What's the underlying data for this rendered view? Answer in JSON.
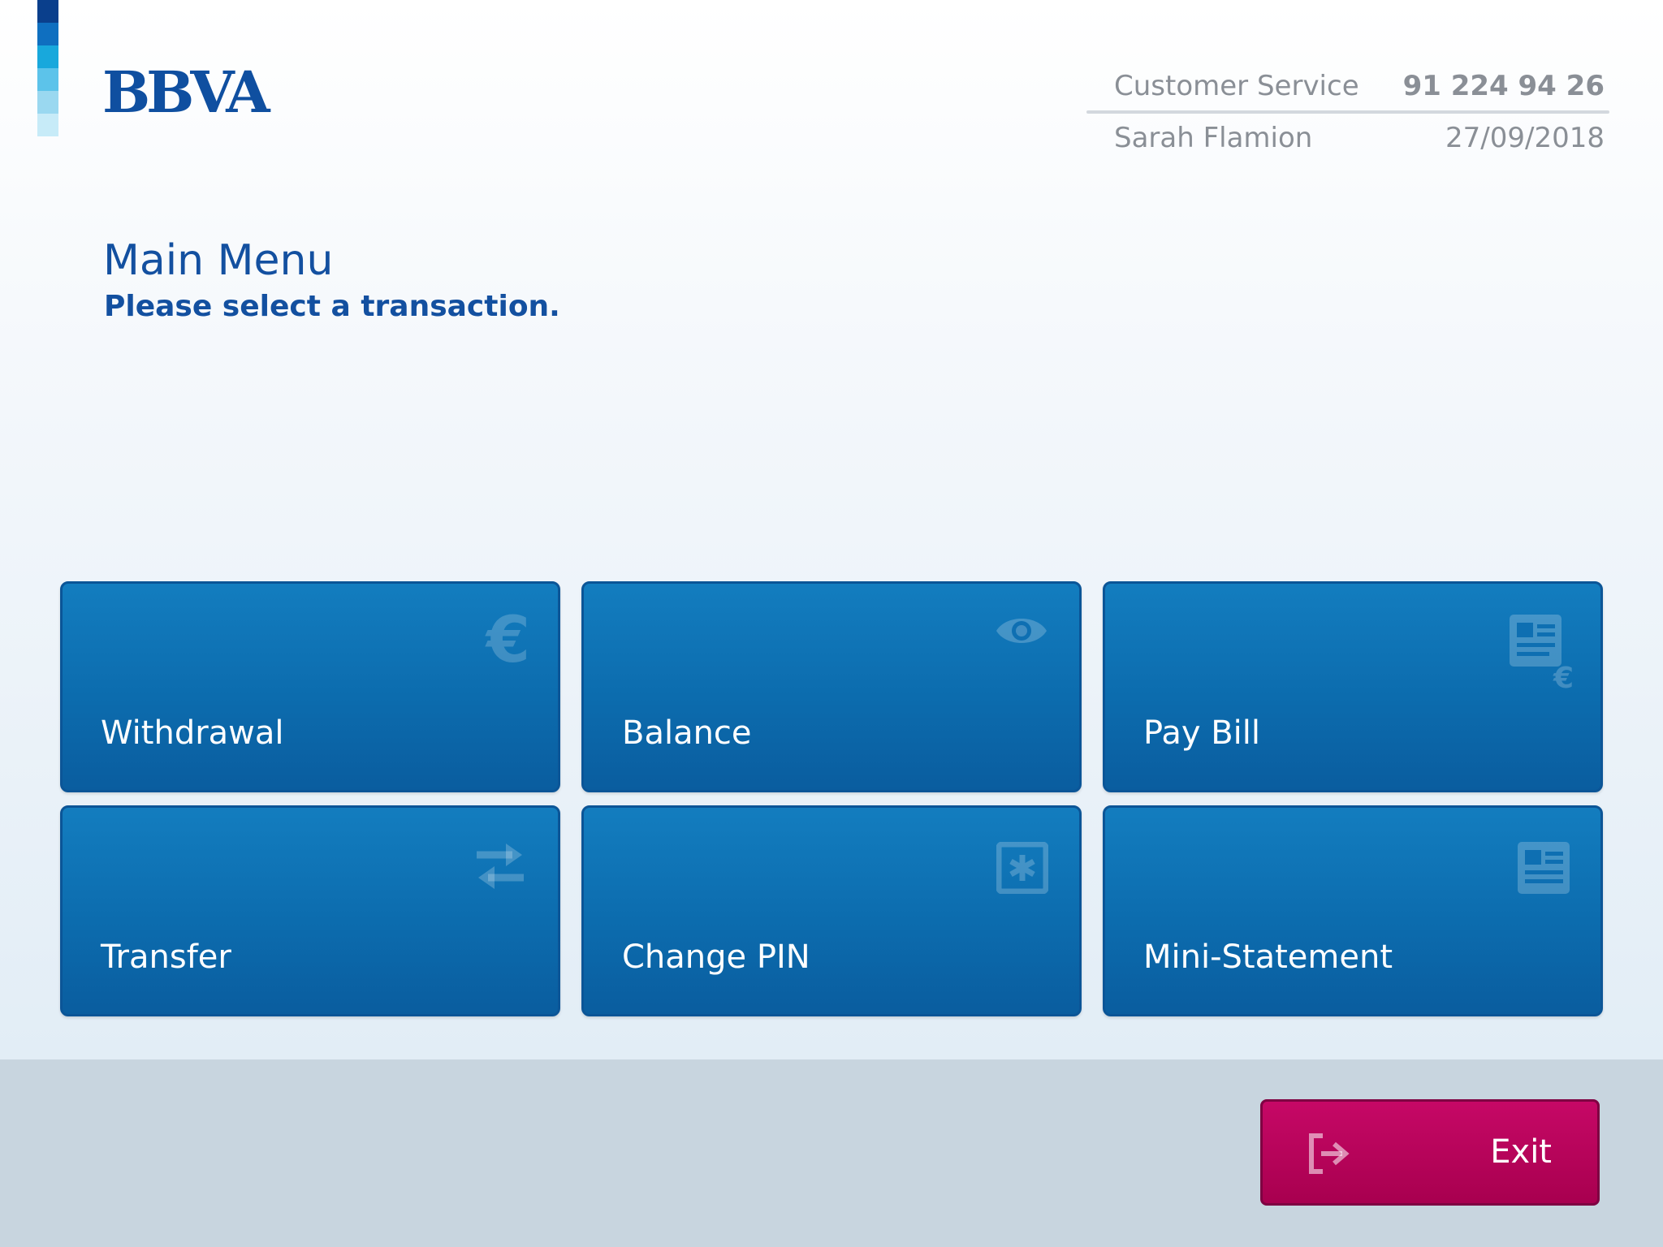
{
  "brand": {
    "logo_text": "BBVA",
    "stripe_colors": [
      "#0a3f8c",
      "#0f6fc0",
      "#18a8dc",
      "#5cc3ea",
      "#9ad8f0",
      "#c7ebf8"
    ]
  },
  "header": {
    "customer_service_label": "Customer Service",
    "customer_service_phone": "91 224 94 26",
    "user_name": "Sarah Flamion",
    "date": "27/09/2018"
  },
  "main": {
    "title": "Main Menu",
    "subtitle": "Please select a transaction."
  },
  "transactions": [
    {
      "label": "Withdrawal",
      "icon": "euro-icon"
    },
    {
      "label": "Balance",
      "icon": "eye-icon"
    },
    {
      "label": "Pay Bill",
      "icon": "bill-euro-icon"
    },
    {
      "label": "Transfer",
      "icon": "transfer-arrows-icon"
    },
    {
      "label": "Change PIN",
      "icon": "pin-asterisk-icon"
    },
    {
      "label": "Mini-Statement",
      "icon": "statement-icon"
    }
  ],
  "footer": {
    "exit_label": "Exit",
    "exit_icon": "exit-icon"
  },
  "colors": {
    "brand_blue": "#1350a0",
    "tile_blue": "#0f72b4",
    "exit_magenta": "#b80059",
    "footer_gray": "#c8d5df"
  }
}
